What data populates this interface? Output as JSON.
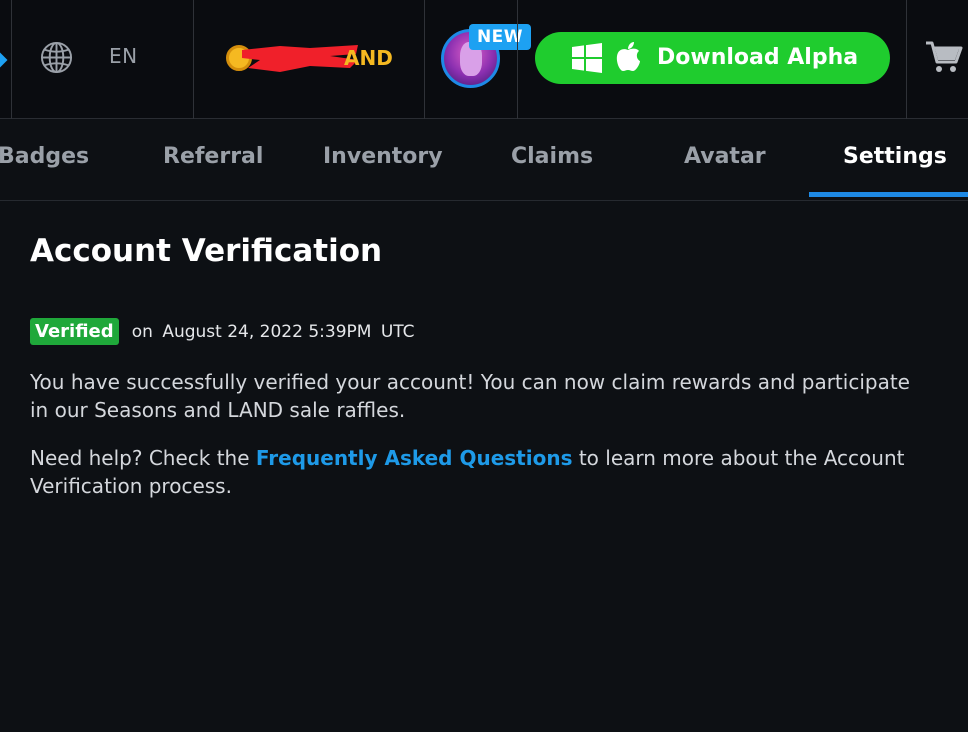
{
  "header": {
    "language": "EN",
    "balance_suffix": "AND",
    "new_badge": "NEW",
    "download_label": "Download Alpha"
  },
  "tabs": [
    {
      "label": "Badges"
    },
    {
      "label": "Referral"
    },
    {
      "label": "Inventory"
    },
    {
      "label": "Claims"
    },
    {
      "label": "Avatar"
    },
    {
      "label": "Settings",
      "active": true
    }
  ],
  "main": {
    "title": "Account Verification",
    "status_badge": "Verified",
    "on_text": "on",
    "verified_date": "August 24, 2022 5:39PM",
    "timezone": "UTC",
    "success_message": "You have successfully verified your account! You can now claim rewards and participate in our Seasons and LAND sale raffles.",
    "help_prefix": "Need help? Check the ",
    "help_link": "Frequently Asked Questions",
    "help_suffix": " to learn more about the Account Verification process."
  },
  "colors": {
    "accent_blue": "#1e8ae6",
    "download_green": "#1fcc2e",
    "verified_green": "#1fa83a",
    "coin_gold": "#f5b921",
    "link_blue": "#1e9ae8"
  },
  "icons": [
    "diamond-icon",
    "globe-icon",
    "coin-icon",
    "windows-icon",
    "apple-icon",
    "cart-icon"
  ]
}
